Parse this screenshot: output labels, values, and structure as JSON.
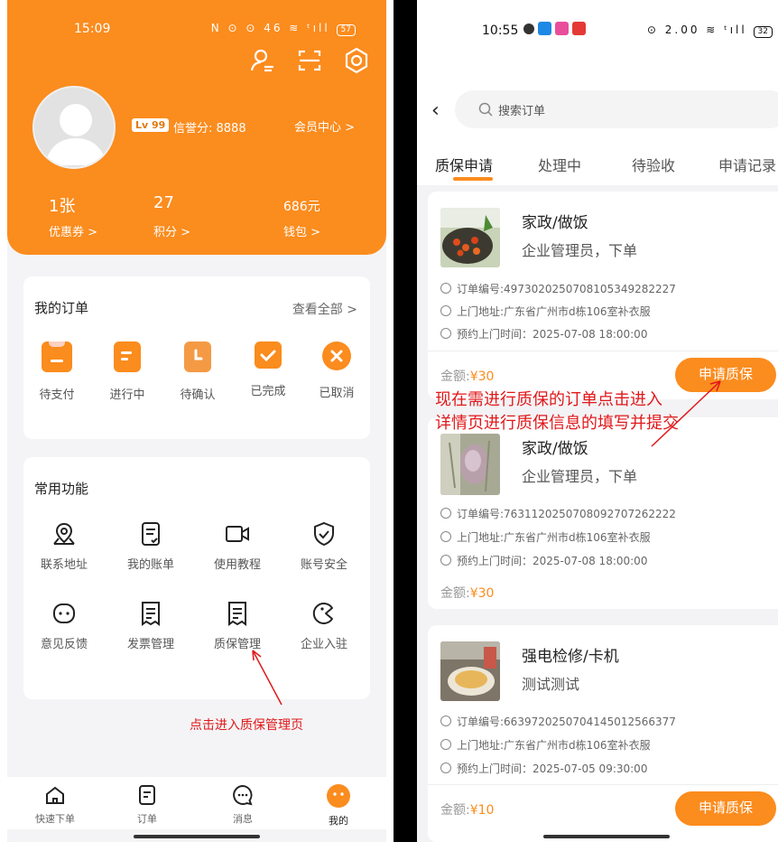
{
  "left": {
    "status": {
      "time": "15:09",
      "icons": "N ⊙ ⊙ 46 ≋ ᵗıll",
      "battery": "57"
    },
    "profile": {
      "level": "Lv 99",
      "credit": "信誉分: 8888",
      "member_center": "会员中心 >"
    },
    "stats": [
      {
        "value": "1张",
        "label": "优惠券 >"
      },
      {
        "value": "27",
        "label": "积分 >"
      },
      {
        "value": "686元",
        "label": "钱包 >"
      }
    ],
    "orders": {
      "title": "我的订单",
      "see_all": "查看全部 >",
      "items": [
        {
          "label": "待支付",
          "icon": "wallet-icon"
        },
        {
          "label": "进行中",
          "icon": "doc-icon"
        },
        {
          "label": "待确认",
          "icon": "clock-icon"
        },
        {
          "label": "已完成",
          "icon": "check-icon"
        },
        {
          "label": "已取消",
          "icon": "cancel-icon"
        }
      ]
    },
    "functions": {
      "title": "常用功能",
      "items": [
        {
          "label": "联系地址",
          "icon": "map-pin-icon"
        },
        {
          "label": "我的账单",
          "icon": "bill-icon"
        },
        {
          "label": "使用教程",
          "icon": "video-icon"
        },
        {
          "label": "账号安全",
          "icon": "shield-icon"
        },
        {
          "label": "意见反馈",
          "icon": "feedback-icon"
        },
        {
          "label": "发票管理",
          "icon": "invoice-icon"
        },
        {
          "label": "质保管理",
          "icon": "warranty-icon"
        },
        {
          "label": "企业入驻",
          "icon": "enterprise-icon"
        }
      ]
    },
    "annotation": "点击进入质保管理页",
    "tabbar": [
      {
        "label": "快速下单",
        "icon": "home-icon"
      },
      {
        "label": "订单",
        "icon": "order-icon"
      },
      {
        "label": "消息",
        "icon": "message-icon"
      },
      {
        "label": "我的",
        "icon": "mine-icon"
      }
    ]
  },
  "right": {
    "status": {
      "time": "10:55",
      "icons": "⊙ 2.00 ≋ ᵗıll",
      "battery": "32"
    },
    "search_placeholder": "搜索订单",
    "tabs": [
      "质保申请",
      "处理中",
      "待验收",
      "申请记录"
    ],
    "annotation": [
      "现在需进行质保的订单点击进入",
      "详情页进行质保信息的填写并提交"
    ],
    "orders": [
      {
        "title": "家政/做饭",
        "subtitle": "企业管理员，下单",
        "order_no": "订单编号:4973020250708105349282227",
        "address": "上门地址:广东省广州市d栋106室补衣服",
        "time": "预约上门时间：2025-07-08 18:00:00",
        "amount_label": "金额:",
        "amount": "¥30",
        "button": "申请质保"
      },
      {
        "title": "家政/做饭",
        "subtitle": "企业管理员，下单",
        "order_no": "订单编号:7631120250708092707262222",
        "address": "上门地址:广东省广州市d栋106室补衣服",
        "time": "预约上门时间：2025-07-08 18:00:00",
        "amount_label": "金额:",
        "amount": "¥30"
      },
      {
        "title": "强电检修/卡机",
        "subtitle": "测试测试",
        "order_no": "订单编号:6639720250704145012566377",
        "address": "上门地址:广东省广州市d栋106室补衣服",
        "time": "预约上门时间：2025-07-05 09:30:00",
        "amount_label": "金额:",
        "amount": "¥10",
        "button": "申请质保"
      }
    ]
  }
}
